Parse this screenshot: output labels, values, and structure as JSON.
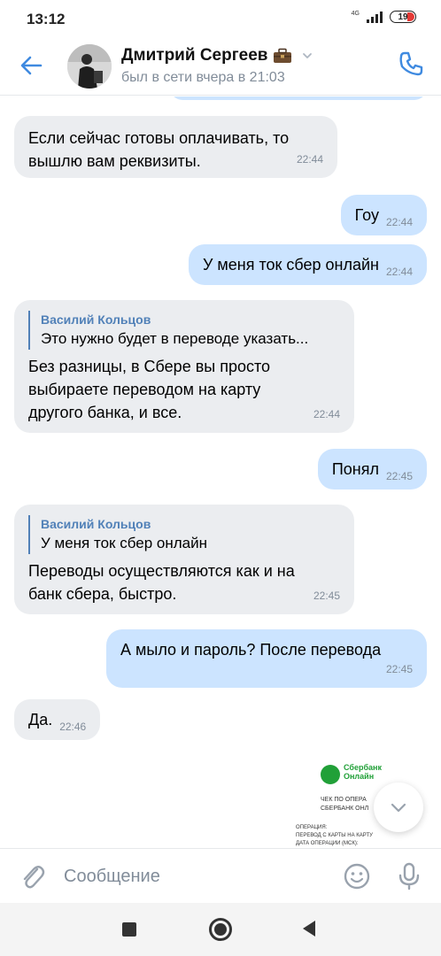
{
  "status_bar": {
    "time": "13:12",
    "network": "4G",
    "battery": "19"
  },
  "header": {
    "contact_name": "Дмитрий Сергеев",
    "last_seen": "был в сети вчера в 21:03"
  },
  "messages": [
    {
      "direction": "in",
      "text_lines": [
        "Если сейчас готовы оплачивать, то",
        "вышлю вам реквизиты."
      ],
      "time": "22:44"
    },
    {
      "direction": "out",
      "text": "Гоу",
      "time": "22:44"
    },
    {
      "direction": "out",
      "text": "У меня ток сбер онлайн",
      "time": "22:44"
    },
    {
      "direction": "in",
      "reply_author": "Василий Кольцов",
      "reply_text": "Это нужно будет в переводе указать...",
      "text_lines": [
        "Без разницы, в Сбере вы просто",
        "выбираете переводом на карту",
        "другого банка, и все."
      ],
      "time": "22:44"
    },
    {
      "direction": "out",
      "text": "Понял",
      "time": "22:45"
    },
    {
      "direction": "in",
      "reply_author": "Василий Кольцов",
      "reply_text": "У меня ток сбер онлайн",
      "text_lines": [
        "Переводы осуществляются как и на",
        "банк сбера, быстро."
      ],
      "time": "22:45"
    },
    {
      "direction": "out",
      "text": "А мыло и пароль? После перевода",
      "time": "22:45"
    },
    {
      "direction": "in",
      "text": "Да.",
      "time": "22:46"
    }
  ],
  "receipt": {
    "brand_line1": "Сбербанк",
    "brand_line2": "Онлайн",
    "line1": "ЧЕК ПО ОПЕРА",
    "line2": "СБЕРБАНК ОНЛ",
    "small1": "ОПЕРАЦИЯ:",
    "small2": "ПЕРЕВОД С КАРТЫ НА КАРТУ",
    "small3": "ДАТА ОПЕРАЦИИ (МСК):"
  },
  "input": {
    "placeholder": "Сообщение"
  },
  "icons": {
    "back": "arrow-left-icon",
    "briefcase": "briefcase-emoji-icon",
    "call": "phone-icon",
    "attach": "paperclip-icon",
    "emoji": "smile-icon",
    "mic": "microphone-icon",
    "scroll": "chevron-down-icon"
  },
  "colors": {
    "accent": "#3f8ae0",
    "incoming_bubble": "#ebedf0",
    "outgoing_bubble": "#cce4ff",
    "secondary_text": "#818c99",
    "reply_author": "#5181b8"
  }
}
